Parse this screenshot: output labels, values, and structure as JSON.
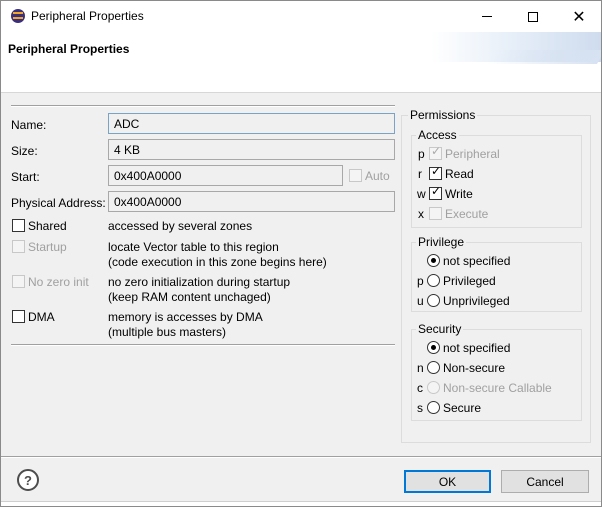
{
  "window": {
    "title": "Peripheral Properties"
  },
  "header": {
    "title": "Peripheral Properties"
  },
  "form": {
    "name_label": "Name:",
    "name_value": "ADC",
    "size_label": "Size:",
    "size_value": "4 KB",
    "start_label": "Start:",
    "start_value": "0x400A0000",
    "auto_label": "Auto",
    "physical_label": "Physical Address:",
    "physical_value": "0x400A0000"
  },
  "options": {
    "shared": {
      "label": "Shared",
      "desc1": "accessed by several zones",
      "checked": false,
      "enabled": true
    },
    "startup": {
      "label": "Startup",
      "desc1": "locate Vector table to this region",
      "desc2": "(code execution in this zone begins here)",
      "checked": false,
      "enabled": false
    },
    "nozero": {
      "label": "No zero init",
      "desc1": "no zero initialization during startup",
      "desc2": "(keep RAM content unchaged)",
      "checked": false,
      "enabled": false
    },
    "dma": {
      "label": "DMA",
      "desc1": "memory is accesses by DMA",
      "desc2": "(multiple bus masters)",
      "checked": false,
      "enabled": true
    }
  },
  "permissions": {
    "title": "Permissions",
    "access": {
      "title": "Access",
      "items": [
        {
          "key": "p",
          "label": "Peripheral",
          "checked": true,
          "enabled": false
        },
        {
          "key": "r",
          "label": "Read",
          "checked": true,
          "enabled": true
        },
        {
          "key": "w",
          "label": "Write",
          "checked": true,
          "enabled": true
        },
        {
          "key": "x",
          "label": "Execute",
          "checked": false,
          "enabled": false
        }
      ]
    },
    "privilege": {
      "title": "Privilege",
      "items": [
        {
          "key": "",
          "label": "not specified",
          "selected": true,
          "enabled": true
        },
        {
          "key": "p",
          "label": "Privileged",
          "selected": false,
          "enabled": true
        },
        {
          "key": "u",
          "label": "Unprivileged",
          "selected": false,
          "enabled": true
        }
      ]
    },
    "security": {
      "title": "Security",
      "items": [
        {
          "key": "",
          "label": "not specified",
          "selected": true,
          "enabled": true
        },
        {
          "key": "n",
          "label": "Non-secure",
          "selected": false,
          "enabled": true
        },
        {
          "key": "c",
          "label": "Non-secure Callable",
          "selected": false,
          "enabled": false
        },
        {
          "key": "s",
          "label": "Secure",
          "selected": false,
          "enabled": true
        }
      ]
    }
  },
  "buttons": {
    "help": "?",
    "ok": "OK",
    "cancel": "Cancel"
  },
  "icons": {
    "app": "eclipse-icon",
    "help": "help-icon",
    "minimize": "minimize-icon",
    "maximize": "maximize-icon",
    "close": "close-icon"
  },
  "colors": {
    "default_button_border": "#0078d7",
    "dialog_bg": "#f0f0f0"
  }
}
